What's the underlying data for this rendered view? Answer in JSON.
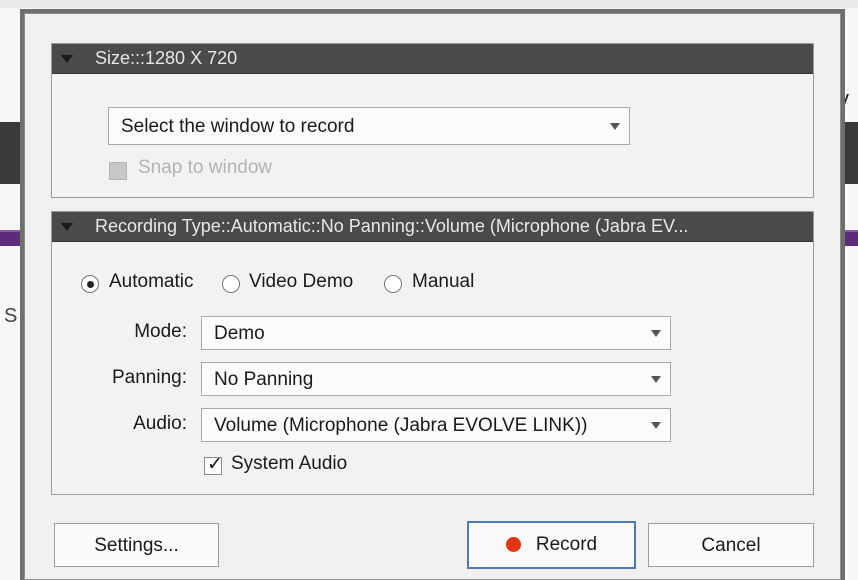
{
  "background": {
    "right_fragment_text": "y",
    "left_fragment_letter": "S"
  },
  "size_panel": {
    "header": "Size:::1280 X 720",
    "window_select": "Select the window to record",
    "snap_label": "Snap to window",
    "snap_checked": false,
    "snap_enabled": false
  },
  "recording_panel": {
    "header": "Recording Type::Automatic::No Panning::Volume (Microphone (Jabra EV...",
    "radios": [
      {
        "label": "Automatic",
        "selected": true
      },
      {
        "label": "Video Demo",
        "selected": false
      },
      {
        "label": "Manual",
        "selected": false
      }
    ],
    "mode_label": "Mode:",
    "mode_value": "Demo",
    "panning_label": "Panning:",
    "panning_value": "No Panning",
    "audio_label": "Audio:",
    "audio_value": "Volume (Microphone (Jabra EVOLVE LINK))",
    "system_audio_label": "System Audio",
    "system_audio_checked": true
  },
  "buttons": {
    "settings": "Settings...",
    "record": "Record",
    "cancel": "Cancel"
  },
  "colors": {
    "panel_header": "#4a4a4a",
    "record_dot": "#e63312",
    "primary_border": "#4d7ab3",
    "purple_band": "#5d2c7a"
  }
}
